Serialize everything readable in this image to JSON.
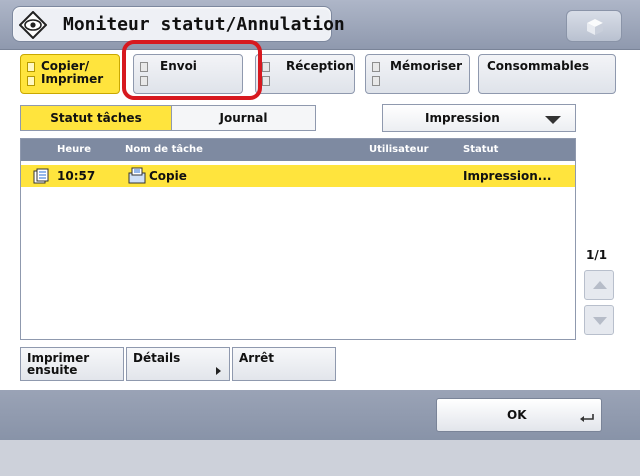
{
  "title": "Moniteur statut/Annulation",
  "tabs": [
    {
      "label_line1": "Copier/",
      "label_line2": "Imprimer",
      "active": true
    },
    {
      "label_line1": "Envoi",
      "label_line2": "",
      "active": false
    },
    {
      "label_line1": "Réception",
      "label_line2": "",
      "active": false
    },
    {
      "label_line1": "Mémoriser",
      "label_line2": "",
      "active": false
    },
    {
      "label_line1": "Consommables",
      "label_line2": "",
      "active": false
    }
  ],
  "sub_tabs": {
    "status": "Statut tâches",
    "log": "Journal"
  },
  "dropdown": {
    "selected": "Impression"
  },
  "list": {
    "headers": {
      "time": "Heure",
      "job_name": "Nom de tâche",
      "user": "Utilisateur",
      "status": "Statut"
    },
    "rows": [
      {
        "time": "10:57",
        "job_name": "Copie",
        "user": "",
        "status": "Impression..."
      }
    ]
  },
  "page_indicator": "1/1",
  "actions": {
    "print_next_line1": "Imprimer",
    "print_next_line2": "ensuite",
    "details": "Détails",
    "stop": "Arrêt"
  },
  "ok_label": "OK",
  "colors": {
    "highlight": "#ffe43d",
    "header": "#7e8aa1",
    "callout": "#d7191f"
  }
}
